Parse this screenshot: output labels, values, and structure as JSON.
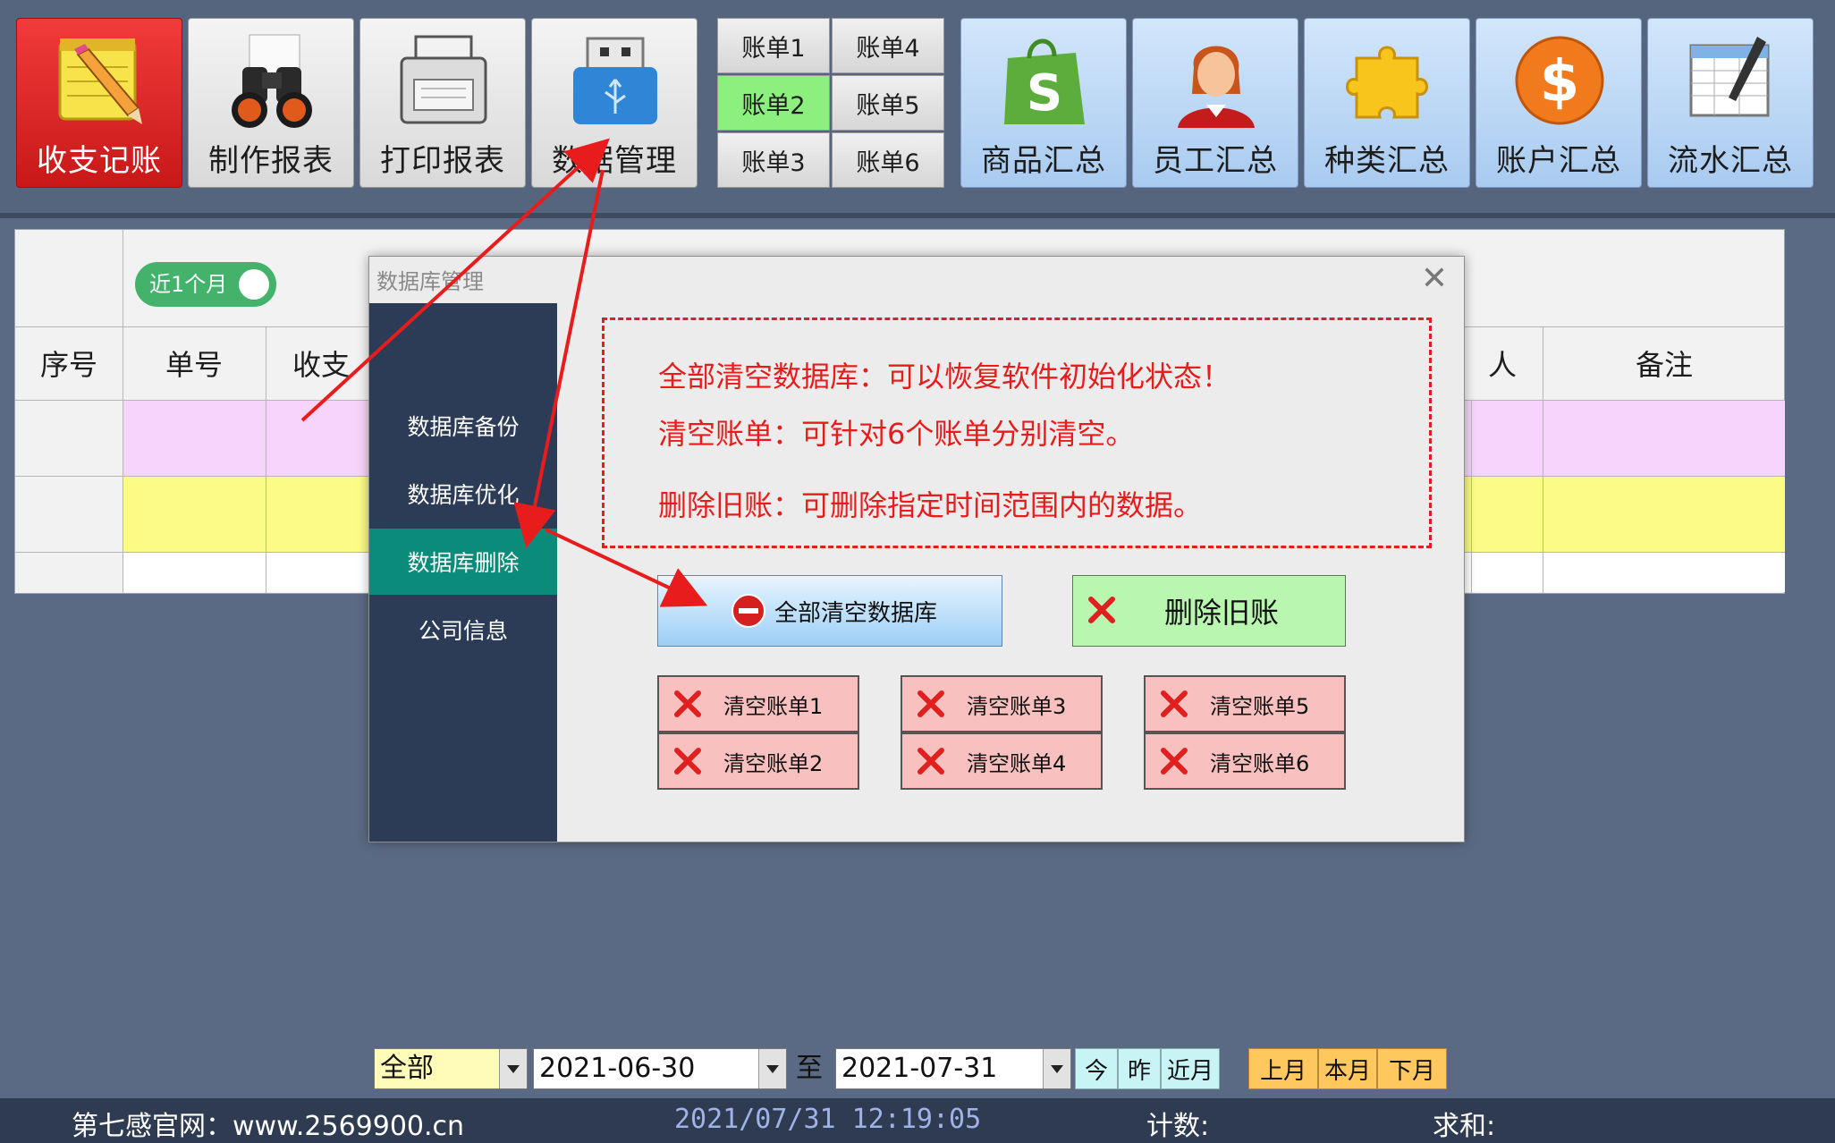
{
  "toolbar": {
    "left_buttons": [
      {
        "label": "收支记账",
        "icon": "pencil-notepad-icon"
      },
      {
        "label": "制作报表",
        "icon": "binoculars-icon"
      },
      {
        "label": "打印报表",
        "icon": "printer-icon"
      },
      {
        "label": "数据管理",
        "icon": "usb-drive-icon"
      }
    ],
    "bills": [
      "账单1",
      "账单4",
      "账单2",
      "账单5",
      "账单3",
      "账单6"
    ],
    "selected_bill": "账单2",
    "right_buttons": [
      {
        "label": "商品汇总",
        "icon": "shopify-bag-icon"
      },
      {
        "label": "员工汇总",
        "icon": "employee-avatar-icon"
      },
      {
        "label": "种类汇总",
        "icon": "puzzle-icon"
      },
      {
        "label": "账户汇总",
        "icon": "dollar-coin-icon"
      },
      {
        "label": "流水汇总",
        "icon": "spreadsheet-pen-icon"
      }
    ]
  },
  "grid": {
    "toggle_label": "近1个月",
    "columns": [
      "序号",
      "单号",
      "收支",
      "人",
      "备注"
    ],
    "row_colors": [
      "#f7d4fb",
      "#fbfb86",
      "#ffffff"
    ]
  },
  "dialog": {
    "title": "数据库管理",
    "close_glyph": "✕",
    "side_items": [
      "数据库备份",
      "数据库优化",
      "数据库删除",
      "公司信息"
    ],
    "selected_side": "数据库删除",
    "notice_lines": [
      "全部清空数据库：可以恢复软件初始化状态！",
      "清空账单：可针对6个账单分别清空。",
      "删除旧账：可删除指定时间范围内的数据。"
    ],
    "btn_clear_all": "全部清空数据库",
    "btn_delete_old": "删除旧账",
    "clear_bill_buttons": [
      "清空账单1",
      "清空账单2",
      "清空账单3",
      "清空账单4",
      "清空账单5",
      "清空账单6"
    ]
  },
  "filter": {
    "type_value": "全部",
    "date_from": "2021-06-30",
    "to_label": "至",
    "date_to": "2021-07-31",
    "quick_buttons": [
      "今",
      "昨",
      "近月"
    ],
    "month_buttons": [
      "上月",
      "本月",
      "下月"
    ]
  },
  "statusbar": {
    "website": "第七感官网：www.2569900.cn",
    "datetime": "2021/07/31 12:19:05",
    "count_label": "计数:",
    "sum_label": "求和:"
  },
  "colors": {
    "accent_red": "#e81c1c",
    "selected_green": "#8cf07e",
    "side_selected": "#0b8b7a",
    "side_bg": "#2c3c56"
  }
}
